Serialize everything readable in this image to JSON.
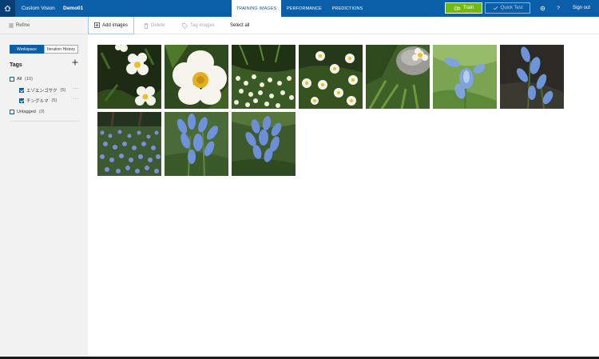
{
  "topbar": {
    "brand": "Custom Vision",
    "project": "Demo01",
    "tabs": [
      {
        "label": "TRAINING IMAGES",
        "active": true
      },
      {
        "label": "PERFORMANCE",
        "active": false
      },
      {
        "label": "PREDICTIONS",
        "active": false
      }
    ],
    "train_label": "Train",
    "quicktest_label": "Quick Test",
    "help_label": "?",
    "signout_label": "Sign out",
    "colors": {
      "bar": "#0a5fa8",
      "train": "#74b80f"
    }
  },
  "sidebar": {
    "refine_label": "Refine",
    "workspace_label": "Workspace",
    "iteration_label": "Iteration History",
    "tags_title": "Tags",
    "tags": [
      {
        "label": "All",
        "count": "(10)",
        "checked": false
      },
      {
        "label": "エゾエンゴサク",
        "count": "(5)",
        "checked": true
      },
      {
        "label": "チングルマ",
        "count": "(5)",
        "checked": true
      }
    ],
    "untagged": {
      "label": "Untagged",
      "count": "(0)"
    }
  },
  "toolbar": {
    "add_images": "Add images",
    "delete": "Delete",
    "tag_images": "Tag images",
    "select_all": "Select all"
  },
  "images": [
    {
      "kind": "white-flower-dark",
      "icon": "image-thumbnail"
    },
    {
      "kind": "white-flower-large",
      "icon": "image-thumbnail"
    },
    {
      "kind": "white-flower-field",
      "icon": "image-thumbnail"
    },
    {
      "kind": "white-flower-cluster",
      "icon": "image-thumbnail"
    },
    {
      "kind": "white-flower-rock",
      "icon": "image-thumbnail"
    },
    {
      "kind": "blue-flower-single",
      "icon": "image-thumbnail"
    },
    {
      "kind": "blue-flower-dark",
      "icon": "image-thumbnail"
    },
    {
      "kind": "blue-flower-field",
      "icon": "image-thumbnail"
    },
    {
      "kind": "blue-flower-cluster",
      "icon": "image-thumbnail"
    },
    {
      "kind": "blue-flower-group",
      "icon": "image-thumbnail"
    }
  ]
}
